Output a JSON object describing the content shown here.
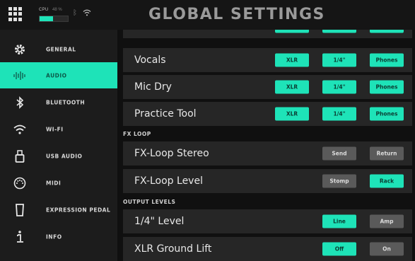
{
  "topbar": {
    "title": "GLOBAL SETTINGS",
    "cpu_label": "CPU",
    "cpu_value": "48 %",
    "cpu_level": 0.48,
    "bluetooth_icon": "bluetooth-icon",
    "wifi_icon": "wifi-icon",
    "menu_icon": "grid-menu-icon"
  },
  "sidebar": {
    "items": [
      {
        "label": "GENERAL",
        "icon": "gear-icon"
      },
      {
        "label": "AUDIO",
        "icon": "waveform-icon",
        "active": true
      },
      {
        "label": "BLUETOOTH",
        "icon": "bluetooth-icon"
      },
      {
        "label": "WI-FI",
        "icon": "wifi-icon"
      },
      {
        "label": "USB AUDIO",
        "icon": "usb-icon"
      },
      {
        "label": "MIDI",
        "icon": "midi-icon"
      },
      {
        "label": "EXPRESSION PEDAL",
        "icon": "pedal-icon"
      },
      {
        "label": "INFO",
        "icon": "info-icon"
      }
    ]
  },
  "main": {
    "rows": [
      {
        "label": "Vocals",
        "buttons": [
          "XLR",
          "1/4\"",
          "Phones"
        ]
      },
      {
        "label": "Mic Dry",
        "buttons": [
          "XLR",
          "1/4\"",
          "Phones"
        ]
      },
      {
        "label": "Practice Tool",
        "buttons": [
          "XLR",
          "1/4\"",
          "Phones"
        ]
      }
    ],
    "fx_loop": {
      "section_label": "FX LOOP",
      "rows": [
        {
          "label": "FX-Loop Stereo",
          "buttons": [
            "Send",
            "Return"
          ]
        },
        {
          "label": "FX-Loop Level",
          "buttons": [
            "Stomp",
            "Rack"
          ]
        }
      ]
    },
    "output_levels": {
      "section_label": "OUTPUT LEVELS",
      "rows": [
        {
          "label": "1/4\" Level",
          "buttons": [
            "Line",
            "Amp"
          ]
        },
        {
          "label": "XLR Ground Lift",
          "buttons": [
            "Off",
            "On"
          ]
        }
      ]
    }
  },
  "colors": {
    "accent": "#1ee3b8",
    "inactive_button": "#5a5a5a",
    "row_background": "#262626",
    "sidebar_background": "#1c1c1c"
  }
}
